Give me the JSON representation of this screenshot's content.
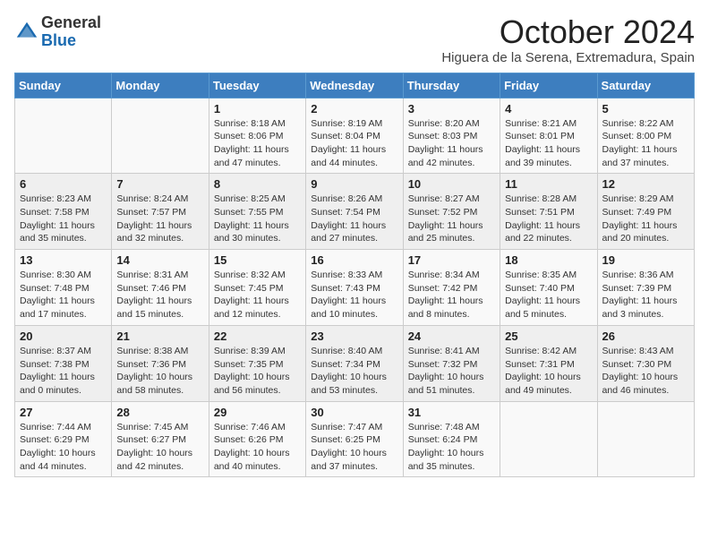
{
  "logo": {
    "general": "General",
    "blue": "Blue"
  },
  "title": "October 2024",
  "location": "Higuera de la Serena, Extremadura, Spain",
  "days_of_week": [
    "Sunday",
    "Monday",
    "Tuesday",
    "Wednesday",
    "Thursday",
    "Friday",
    "Saturday"
  ],
  "weeks": [
    [
      {
        "day": "",
        "info": ""
      },
      {
        "day": "",
        "info": ""
      },
      {
        "day": "1",
        "info": "Sunrise: 8:18 AM\nSunset: 8:06 PM\nDaylight: 11 hours and 47 minutes."
      },
      {
        "day": "2",
        "info": "Sunrise: 8:19 AM\nSunset: 8:04 PM\nDaylight: 11 hours and 44 minutes."
      },
      {
        "day": "3",
        "info": "Sunrise: 8:20 AM\nSunset: 8:03 PM\nDaylight: 11 hours and 42 minutes."
      },
      {
        "day": "4",
        "info": "Sunrise: 8:21 AM\nSunset: 8:01 PM\nDaylight: 11 hours and 39 minutes."
      },
      {
        "day": "5",
        "info": "Sunrise: 8:22 AM\nSunset: 8:00 PM\nDaylight: 11 hours and 37 minutes."
      }
    ],
    [
      {
        "day": "6",
        "info": "Sunrise: 8:23 AM\nSunset: 7:58 PM\nDaylight: 11 hours and 35 minutes."
      },
      {
        "day": "7",
        "info": "Sunrise: 8:24 AM\nSunset: 7:57 PM\nDaylight: 11 hours and 32 minutes."
      },
      {
        "day": "8",
        "info": "Sunrise: 8:25 AM\nSunset: 7:55 PM\nDaylight: 11 hours and 30 minutes."
      },
      {
        "day": "9",
        "info": "Sunrise: 8:26 AM\nSunset: 7:54 PM\nDaylight: 11 hours and 27 minutes."
      },
      {
        "day": "10",
        "info": "Sunrise: 8:27 AM\nSunset: 7:52 PM\nDaylight: 11 hours and 25 minutes."
      },
      {
        "day": "11",
        "info": "Sunrise: 8:28 AM\nSunset: 7:51 PM\nDaylight: 11 hours and 22 minutes."
      },
      {
        "day": "12",
        "info": "Sunrise: 8:29 AM\nSunset: 7:49 PM\nDaylight: 11 hours and 20 minutes."
      }
    ],
    [
      {
        "day": "13",
        "info": "Sunrise: 8:30 AM\nSunset: 7:48 PM\nDaylight: 11 hours and 17 minutes."
      },
      {
        "day": "14",
        "info": "Sunrise: 8:31 AM\nSunset: 7:46 PM\nDaylight: 11 hours and 15 minutes."
      },
      {
        "day": "15",
        "info": "Sunrise: 8:32 AM\nSunset: 7:45 PM\nDaylight: 11 hours and 12 minutes."
      },
      {
        "day": "16",
        "info": "Sunrise: 8:33 AM\nSunset: 7:43 PM\nDaylight: 11 hours and 10 minutes."
      },
      {
        "day": "17",
        "info": "Sunrise: 8:34 AM\nSunset: 7:42 PM\nDaylight: 11 hours and 8 minutes."
      },
      {
        "day": "18",
        "info": "Sunrise: 8:35 AM\nSunset: 7:40 PM\nDaylight: 11 hours and 5 minutes."
      },
      {
        "day": "19",
        "info": "Sunrise: 8:36 AM\nSunset: 7:39 PM\nDaylight: 11 hours and 3 minutes."
      }
    ],
    [
      {
        "day": "20",
        "info": "Sunrise: 8:37 AM\nSunset: 7:38 PM\nDaylight: 11 hours and 0 minutes."
      },
      {
        "day": "21",
        "info": "Sunrise: 8:38 AM\nSunset: 7:36 PM\nDaylight: 10 hours and 58 minutes."
      },
      {
        "day": "22",
        "info": "Sunrise: 8:39 AM\nSunset: 7:35 PM\nDaylight: 10 hours and 56 minutes."
      },
      {
        "day": "23",
        "info": "Sunrise: 8:40 AM\nSunset: 7:34 PM\nDaylight: 10 hours and 53 minutes."
      },
      {
        "day": "24",
        "info": "Sunrise: 8:41 AM\nSunset: 7:32 PM\nDaylight: 10 hours and 51 minutes."
      },
      {
        "day": "25",
        "info": "Sunrise: 8:42 AM\nSunset: 7:31 PM\nDaylight: 10 hours and 49 minutes."
      },
      {
        "day": "26",
        "info": "Sunrise: 8:43 AM\nSunset: 7:30 PM\nDaylight: 10 hours and 46 minutes."
      }
    ],
    [
      {
        "day": "27",
        "info": "Sunrise: 7:44 AM\nSunset: 6:29 PM\nDaylight: 10 hours and 44 minutes."
      },
      {
        "day": "28",
        "info": "Sunrise: 7:45 AM\nSunset: 6:27 PM\nDaylight: 10 hours and 42 minutes."
      },
      {
        "day": "29",
        "info": "Sunrise: 7:46 AM\nSunset: 6:26 PM\nDaylight: 10 hours and 40 minutes."
      },
      {
        "day": "30",
        "info": "Sunrise: 7:47 AM\nSunset: 6:25 PM\nDaylight: 10 hours and 37 minutes."
      },
      {
        "day": "31",
        "info": "Sunrise: 7:48 AM\nSunset: 6:24 PM\nDaylight: 10 hours and 35 minutes."
      },
      {
        "day": "",
        "info": ""
      },
      {
        "day": "",
        "info": ""
      }
    ]
  ]
}
